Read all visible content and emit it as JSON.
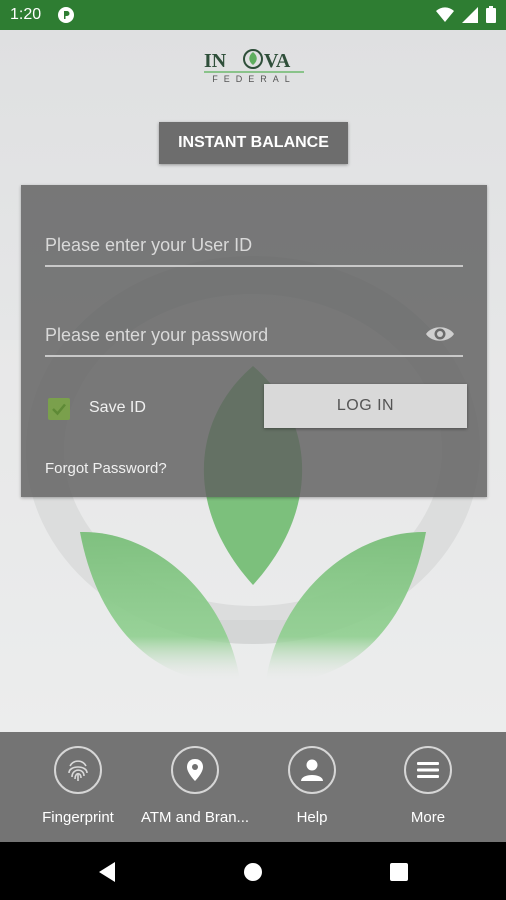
{
  "status_bar": {
    "time": "1:20",
    "app_icon": "reader-p-icon",
    "icons": [
      "wifi-icon",
      "signal-icon",
      "battery-icon"
    ],
    "color": "#2e7d32"
  },
  "logo": {
    "line1": "IN  VA",
    "line2": "FEDERAL"
  },
  "instant_balance_label": "INSTANT BALANCE",
  "login": {
    "user_id_placeholder": "Please enter your User ID",
    "password_placeholder": "Please enter your password",
    "save_id_label": "Save ID",
    "save_id_checked": true,
    "login_label": "LOG IN",
    "forgot_label": "Forgot Password?"
  },
  "bottom_nav": {
    "items": [
      {
        "label": "Fingerprint",
        "icon": "fingerprint-icon"
      },
      {
        "label": "ATM and Bran...",
        "icon": "location-pin-icon"
      },
      {
        "label": "Help",
        "icon": "person-icon"
      },
      {
        "label": "More",
        "icon": "menu-icon"
      }
    ]
  },
  "colors": {
    "brand_green": "#2e7d32",
    "leaf_green": "#7fc07f",
    "card": "#5f5f5f",
    "nav": "#747474"
  }
}
